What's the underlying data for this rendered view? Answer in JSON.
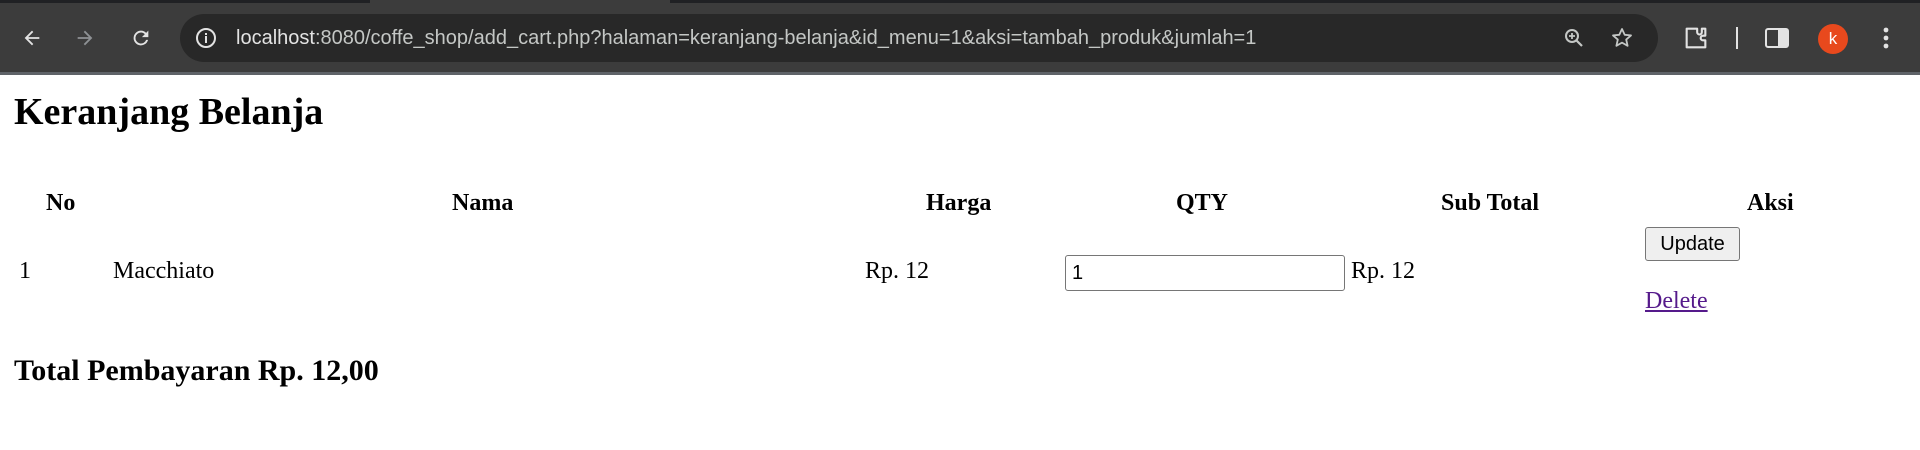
{
  "browser": {
    "url_host": "localhost",
    "url_rest": ":8080/coffe_shop/add_cart.php?halaman=keranjang-belanja&id_menu=1&aksi=tambah_produk&jumlah=1",
    "profile_initial": "k",
    "colors": {
      "toolbar": "#3c3c3c",
      "omnibox": "#282828",
      "avatar": "#e8491d"
    },
    "icons": [
      "back-arrow-icon",
      "forward-arrow-icon",
      "reload-icon",
      "site-info-icon",
      "zoom-icon",
      "bookmark-star-icon",
      "extensions-icon",
      "side-panel-icon",
      "kebab-menu-icon"
    ]
  },
  "page": {
    "title": "Keranjang Belanja",
    "table": {
      "headers": [
        "No",
        "Nama",
        "Harga",
        "QTY",
        "Sub Total",
        "Aksi"
      ],
      "rows": [
        {
          "no": "1",
          "nama": "Macchiato",
          "harga": "Rp. 12",
          "qty": "1",
          "subtotal": "Rp. 12",
          "update_label": "Update",
          "delete_label": "Delete"
        }
      ]
    },
    "total": "Total Pembayaran Rp. 12,00"
  }
}
